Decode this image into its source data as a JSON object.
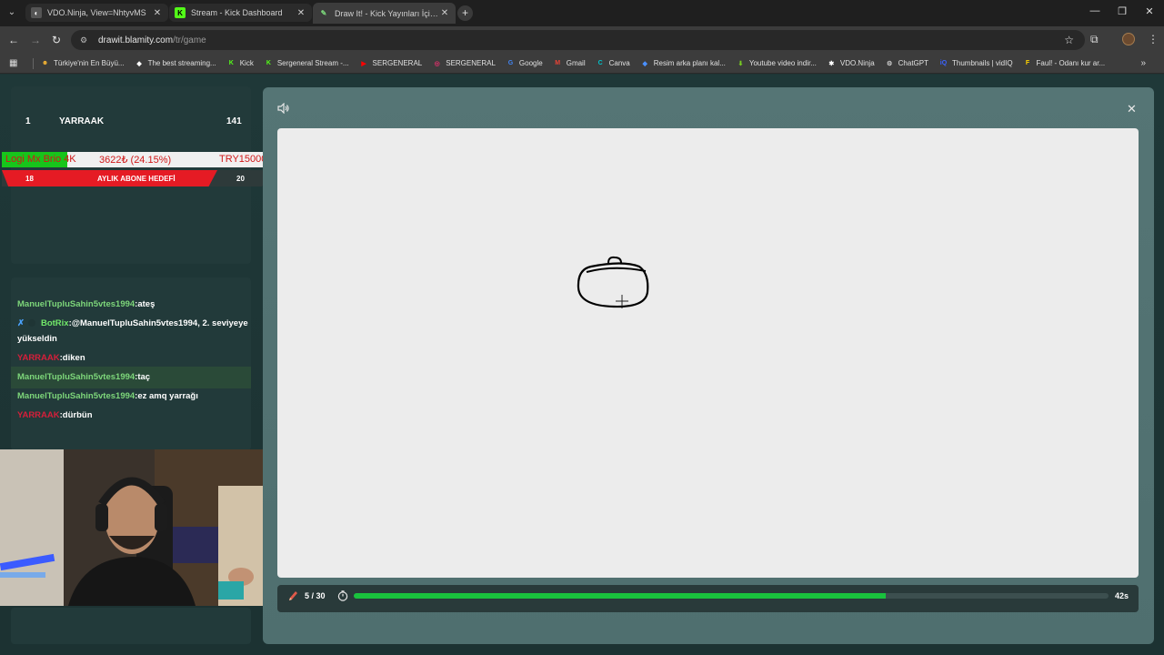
{
  "tabs": [
    {
      "title": "VDO.Ninja, View=NhtyvMS",
      "active": false
    },
    {
      "title": "Stream - Kick Dashboard",
      "active": false
    },
    {
      "title": "Draw It! - Kick Yayınları İçin Çiz",
      "active": true
    }
  ],
  "address": {
    "host": "drawit.blamity.com",
    "path": "/tr/game"
  },
  "bookmarks": [
    {
      "label": "Türkiye'nin En Büyü...",
      "icon": "yellow-face-icon",
      "color": "#f2b233"
    },
    {
      "label": "The best streaming...",
      "icon": "diamond-icon",
      "color": "#ffffff"
    },
    {
      "label": "Kick",
      "icon": "kick-icon",
      "color": "#53fc18"
    },
    {
      "label": "Sergeneral Stream -...",
      "icon": "kick-icon",
      "color": "#53fc18"
    },
    {
      "label": "SERGENERAL",
      "icon": "youtube-icon",
      "color": "#ff0000"
    },
    {
      "label": "SERGENERAL",
      "icon": "instagram-icon",
      "color": "#e1306c"
    },
    {
      "label": "Google",
      "icon": "google-icon",
      "color": "#4285f4"
    },
    {
      "label": "Gmail",
      "icon": "gmail-icon",
      "color": "#ea4335"
    },
    {
      "label": "Canva",
      "icon": "canva-icon",
      "color": "#00c4cc"
    },
    {
      "label": "Resim arka planı kal...",
      "icon": "gem-icon",
      "color": "#4a90ff"
    },
    {
      "label": "Youtube video indir...",
      "icon": "download-icon",
      "color": "#77cc22"
    },
    {
      "label": "VDO.Ninja",
      "icon": "ninja-icon",
      "color": "#ffffff"
    },
    {
      "label": "ChatGPT",
      "icon": "chatgpt-icon",
      "color": "#cccccc"
    },
    {
      "label": "Thumbnails | vidIQ",
      "icon": "vidiq-icon",
      "color": "#3b63ff"
    },
    {
      "label": "Faul! - Odanı kur ar...",
      "icon": "faul-icon",
      "color": "#ffd400"
    }
  ],
  "leaderboard": {
    "rank": "1",
    "name": "YARRAAK",
    "score": "141"
  },
  "donation_goal": {
    "name": "Logi Mx Brio 4K",
    "amount": "3622₺ (24.15%)",
    "target": "TRY15000",
    "progress": 0.2415
  },
  "sub_goal": {
    "from": "18",
    "label": "AYLIK ABONE HEDEFİ",
    "to": "20"
  },
  "chat": [
    {
      "user": "ManuelTupluSahin5vtes1994",
      "text": ":ateş",
      "color": "green"
    },
    {
      "user": "BotRix",
      "text": ":@ManuelTupluSahin5vtes1994, 2. seviyeye yükseldin",
      "color": "bot"
    },
    {
      "user": "YARRAAK",
      "text": ":diken",
      "color": "red"
    },
    {
      "user": "ManuelTupluSahin5vtes1994",
      "text": ":taç",
      "color": "green"
    },
    {
      "user": "ManuelTupluSahin5vtes1994",
      "text": ":ez amq yarrağı",
      "color": "green"
    },
    {
      "user": "YARRAAK",
      "text": ":dürbün",
      "color": "red"
    }
  ],
  "game": {
    "round": "5 / 30",
    "seconds_left": "42s",
    "timer_progress": 0.705
  },
  "colors": {
    "accent_green": "#19c23d",
    "kick_green": "#53fc18",
    "chat_red": "#d61f3a"
  }
}
